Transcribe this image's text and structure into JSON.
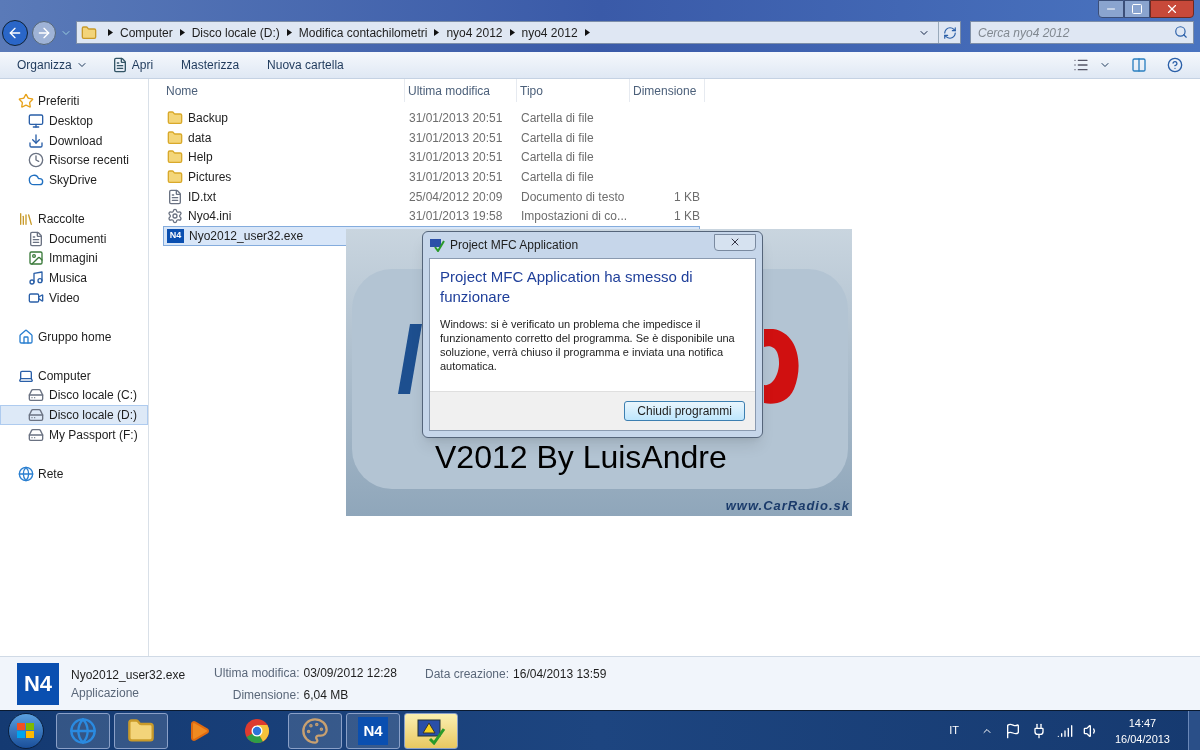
{
  "address_bar": {
    "breadcrumbs": [
      "Computer",
      "Disco locale (D:)",
      "Modifica contachilometri",
      "nyo4 2012",
      "nyo4 2012"
    ]
  },
  "search": {
    "placeholder": "Cerca nyo4 2012"
  },
  "toolbar": {
    "organize": "Organizza",
    "items": [
      "Apri",
      "Masterizza",
      "Nuova cartella"
    ]
  },
  "sidebar": {
    "groups": [
      {
        "label": "Preferiti",
        "kind": "star",
        "children": [
          {
            "label": "Desktop",
            "kind": "desktop",
            "selected": false
          },
          {
            "label": "Download",
            "kind": "download",
            "selected": false
          },
          {
            "label": "Risorse recenti",
            "kind": "recent",
            "selected": false
          },
          {
            "label": "SkyDrive",
            "kind": "cloud",
            "selected": false
          }
        ]
      },
      {
        "label": "Raccolte",
        "kind": "library",
        "children": [
          {
            "label": "Documenti",
            "kind": "docs",
            "selected": false
          },
          {
            "label": "Immagini",
            "kind": "pictures",
            "selected": false
          },
          {
            "label": "Musica",
            "kind": "music",
            "selected": false
          },
          {
            "label": "Video",
            "kind": "video",
            "selected": false
          }
        ]
      },
      {
        "label": "Gruppo home",
        "kind": "home"
      },
      {
        "label": "Computer",
        "kind": "computer",
        "children": [
          {
            "label": "Disco locale (C:)",
            "kind": "drive",
            "selected": false
          },
          {
            "label": "Disco locale (D:)",
            "kind": "drive",
            "selected": true
          },
          {
            "label": "My Passport (F:)",
            "kind": "drive",
            "selected": false
          }
        ]
      },
      {
        "label": "Rete",
        "kind": "network"
      }
    ]
  },
  "table": {
    "columns": [
      "Nome",
      "Ultima modifica",
      "Tipo",
      "Dimensione"
    ],
    "rows": [
      {
        "kind": "folder",
        "name": "Backup",
        "modified": "31/01/2013 20:51",
        "type": "Cartella di file",
        "selected": false
      },
      {
        "kind": "folder",
        "name": "data",
        "modified": "31/01/2013 20:51",
        "type": "Cartella di file",
        "selected": false
      },
      {
        "kind": "folder",
        "name": "Help",
        "modified": "31/01/2013 20:51",
        "type": "Cartella di file",
        "selected": false
      },
      {
        "kind": "folder",
        "name": "Pictures",
        "modified": "31/01/2013 20:51",
        "type": "Cartella di file",
        "selected": false
      },
      {
        "kind": "text",
        "name": "ID.txt",
        "modified": "25/04/2012 20:09",
        "type": "Documento di testo",
        "size": "1 KB",
        "selected": false
      },
      {
        "kind": "settings",
        "name": "Nyo4.ini",
        "modified": "31/01/2013 19:58",
        "type": "Impostazioni di co...",
        "size": "1 KB",
        "selected": false
      },
      {
        "kind": "app",
        "icon_text": "N4",
        "name": "Nyo2012_user32.exe",
        "selected": true
      }
    ]
  },
  "splash": {
    "caption": "V2012 By LuisAndre",
    "url": "www.CarRadio.sk"
  },
  "dialog": {
    "title": "Project MFC Application",
    "heading": "Project MFC Application ha smesso di funzionare",
    "message": "Windows: si è verificato un problema che impedisce il funzionamento corretto del programma. Se è disponibile una soluzione, verrà chiuso il programma e inviata una notifica automatica.",
    "button": "Chiudi programmi"
  },
  "details": {
    "icon_text": "N4",
    "name": "Nyo2012_user32.exe",
    "type": "Applicazione",
    "fields": [
      {
        "label": "Ultima modifica:",
        "value": "03/09/2012 12:28"
      },
      {
        "label": "Dimensione:",
        "value": "6,04 MB"
      },
      {
        "label": "Data creazione:",
        "value": "16/04/2013 13:59"
      }
    ]
  },
  "taskbar": {
    "apps": [
      {
        "kind": "browser-e",
        "running": true,
        "highlighted": false
      },
      {
        "kind": "folder",
        "running": true,
        "highlighted": false
      },
      {
        "kind": "media",
        "running": false,
        "highlighted": false
      },
      {
        "kind": "chrome",
        "running": false,
        "highlighted": false
      },
      {
        "kind": "paint",
        "running": true,
        "highlighted": false
      },
      {
        "kind": "n4",
        "icon_text": "N4",
        "running": true,
        "highlighted": false
      },
      {
        "kind": "warning",
        "running": true,
        "highlighted": true
      }
    ],
    "language": "IT",
    "time": "14:47",
    "date": "16/04/2013"
  }
}
